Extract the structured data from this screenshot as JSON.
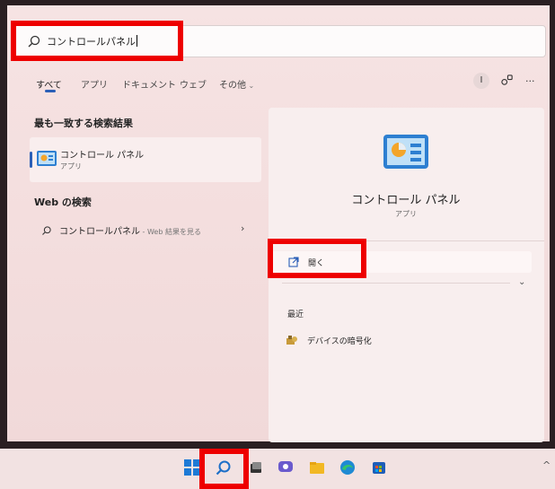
{
  "search": {
    "query": "コントロールパネル"
  },
  "tabs": [
    {
      "label": "すべて"
    },
    {
      "label": "アプリ"
    },
    {
      "label": "ドキュメント"
    },
    {
      "label": "ウェブ"
    },
    {
      "label": "その他"
    }
  ],
  "header": {
    "profile_initial": "I",
    "more_label": "···"
  },
  "best_match": {
    "title": "最も一致する検索結果",
    "name": "コントロール パネル",
    "type": "アプリ"
  },
  "web_search": {
    "title": "Web の検索",
    "query": "コントロールパネル",
    "suffix": " - Web 結果を見る"
  },
  "detail": {
    "name": "コントロール パネル",
    "type": "アプリ",
    "open_label": "開く",
    "recent_title": "最近",
    "recent_items": [
      {
        "label": "デバイスの暗号化"
      }
    ]
  },
  "colors": {
    "accent": "#2a5fb7",
    "highlight_box": "#ee0000"
  },
  "taskbar": {
    "icons": [
      "windows-start-icon",
      "search-icon",
      "task-view-icon",
      "chat-icon",
      "file-explorer-icon",
      "edge-icon",
      "store-icon"
    ]
  }
}
